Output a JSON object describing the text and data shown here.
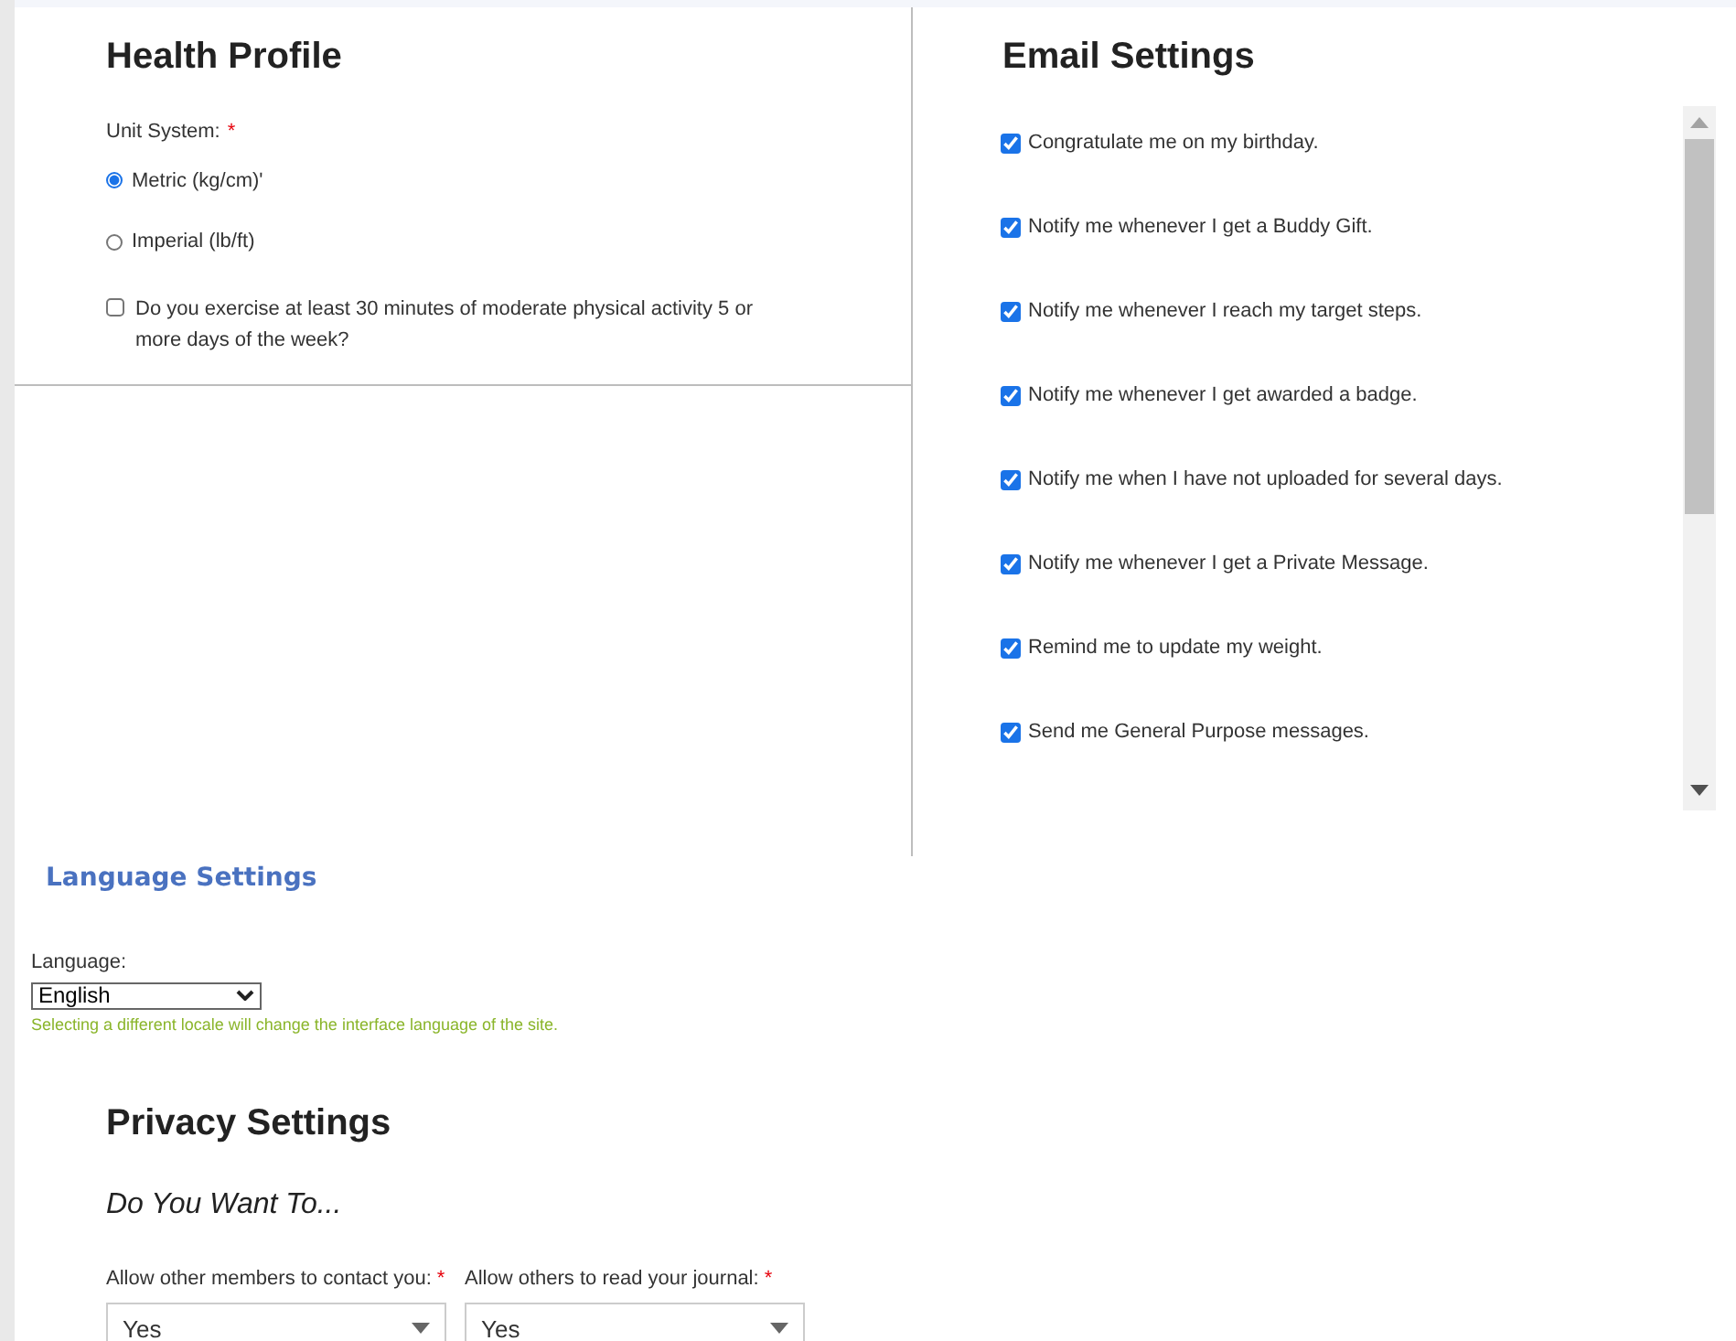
{
  "health_profile": {
    "title": "Health Profile",
    "unit_label": "Unit System:",
    "required_mark": "*",
    "units": [
      {
        "label": "Metric (kg/cm)'",
        "selected": true
      },
      {
        "label": "Imperial (lb/ft)",
        "selected": false
      }
    ],
    "exercise": {
      "label": "Do you exercise at least 30 minutes of moderate physical activity 5 or more days of the week?",
      "checked": false
    }
  },
  "email_settings": {
    "title": "Email Settings",
    "options": [
      {
        "label": "Congratulate me on my birthday.",
        "checked": true
      },
      {
        "label": "Notify me whenever I get a Buddy Gift.",
        "checked": true
      },
      {
        "label": "Notify me whenever I reach my target steps.",
        "checked": true
      },
      {
        "label": "Notify me whenever I get awarded a badge.",
        "checked": true
      },
      {
        "label": "Notify me when I have not uploaded for several days.",
        "checked": true
      },
      {
        "label": "Notify me whenever I get a Private Message.",
        "checked": true
      },
      {
        "label": "Remind me to update my weight.",
        "checked": true
      },
      {
        "label": "Send me General Purpose messages.",
        "checked": true
      }
    ]
  },
  "language_settings": {
    "title": "Language Settings",
    "label": "Language:",
    "value": "English",
    "hint": "Selecting a different locale will change the interface language of the site."
  },
  "privacy_settings": {
    "title": "Privacy Settings",
    "subtitle": "Do You Want To...",
    "fields": [
      {
        "label": "Allow other members to contact you:",
        "required_mark": "*",
        "value": "Yes"
      },
      {
        "label": "Allow others to read your journal:",
        "required_mark": "*",
        "value": "Yes"
      }
    ]
  }
}
